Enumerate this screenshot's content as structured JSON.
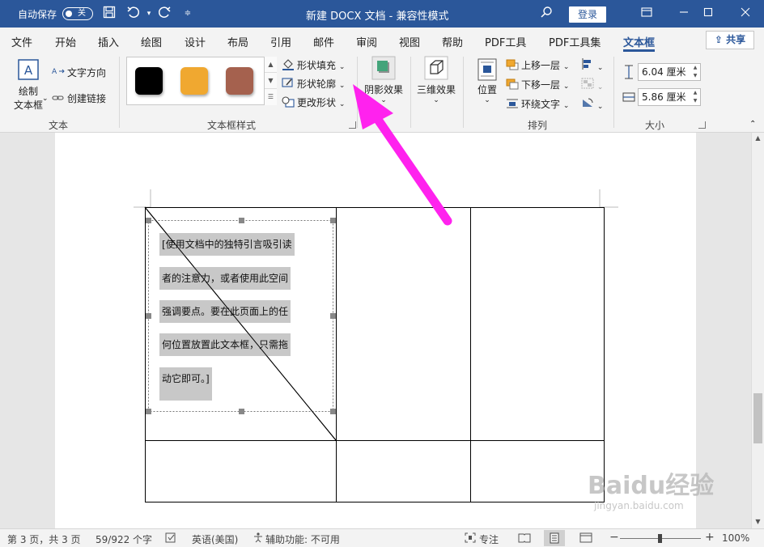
{
  "titlebar": {
    "autosave_label": "自动保存",
    "autosave_state": "关",
    "doc_title": "新建 DOCX 文档  -  兼容性模式",
    "login_label": "登录"
  },
  "tabs": [
    "文件",
    "开始",
    "插入",
    "绘图",
    "设计",
    "布局",
    "引用",
    "邮件",
    "审阅",
    "视图",
    "帮助",
    "PDF工具",
    "PDF工具集",
    "文本框"
  ],
  "share_label": "共享",
  "ribbon": {
    "text_group": {
      "draw_textbox_line1": "绘制",
      "draw_textbox_line2": "文本框",
      "text_direction": "文字方向",
      "create_link": "创建链接",
      "label": "文本"
    },
    "style_group": {
      "swatch_colors": [
        "#000000",
        "#f0a830",
        "#a5614e"
      ],
      "shape_fill": "形状填充",
      "shape_outline": "形状轮廓",
      "change_shape": "更改形状",
      "label": "文本框样式"
    },
    "shadow_label": "阴影效果",
    "threed_label": "三维效果",
    "arrange_group": {
      "position": "位置",
      "bring_forward": "上移一层",
      "send_backward": "下移一层",
      "wrap_text": "环绕文字",
      "label": "排列"
    },
    "size_group": {
      "height": "6.04 厘米",
      "width": "5.86 厘米",
      "label": "大小"
    }
  },
  "document": {
    "textbox_lines": [
      "[使用文档中的独特引言吸引读",
      "者的注意力，或者使用此空间",
      "强调要点。要在此页面上的任",
      "何位置放置此文本框，只需拖",
      "动它即可。]"
    ]
  },
  "statusbar": {
    "page": "第 3 页，共 3 页",
    "words": "59/922 个字",
    "language": "英语(美国)",
    "accessibility": "辅助功能: 不可用",
    "focus": "专注",
    "zoom": "100%"
  },
  "watermark": {
    "brand": "Baidu经验",
    "url": "jingyan.baidu.com"
  },
  "accent_color": "#2b579a",
  "arrow_color": "#ff22ee"
}
